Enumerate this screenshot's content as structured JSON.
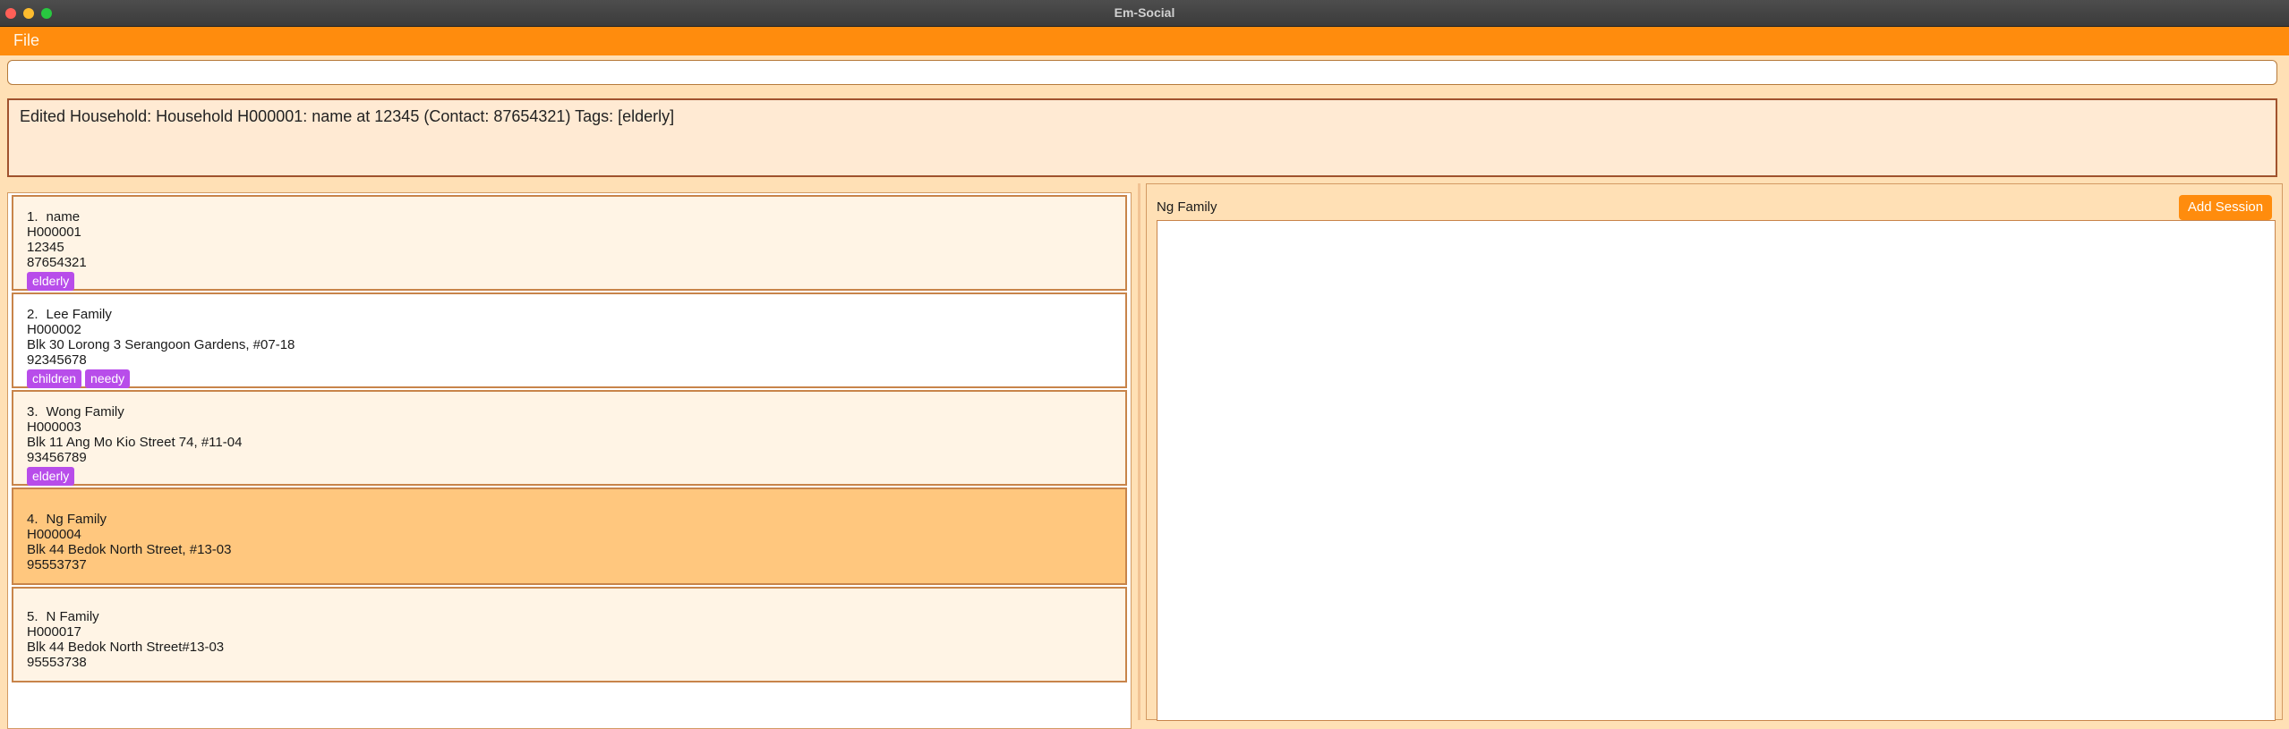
{
  "window": {
    "title": "Em-Social"
  },
  "menu": {
    "file_label": "File"
  },
  "command_box": {
    "value": ""
  },
  "result_display": {
    "text": "Edited Household: Household H000001: name at 12345 (Contact: 87654321) Tags: [elderly]"
  },
  "households": [
    {
      "index": "1.",
      "name": "name",
      "id": "H000001",
      "address": "12345",
      "contact": "87654321",
      "tags": [
        "elderly"
      ]
    },
    {
      "index": "2.",
      "name": "Lee Family",
      "id": "H000002",
      "address": "Blk 30 Lorong 3 Serangoon Gardens, #07-18",
      "contact": "92345678",
      "tags": [
        "children",
        "needy"
      ]
    },
    {
      "index": "3.",
      "name": "Wong Family",
      "id": "H000003",
      "address": "Blk 11 Ang Mo Kio Street 74, #11-04",
      "contact": "93456789",
      "tags": [
        "elderly"
      ]
    },
    {
      "index": "4.",
      "name": "Ng Family",
      "id": "H000004",
      "address": "Blk 44 Bedok North Street, #13-03",
      "contact": "95553737",
      "tags": []
    },
    {
      "index": "5.",
      "name": "N Family",
      "id": "H000017",
      "address": "Blk 44 Bedok North Street#13-03",
      "contact": "95553738",
      "tags": []
    }
  ],
  "detail": {
    "title": "Ng Family",
    "add_session_label": "Add Session"
  },
  "colors": {
    "accent": "#ff8c0d",
    "tag": "#b84dea",
    "selected": "#ffc77e"
  }
}
